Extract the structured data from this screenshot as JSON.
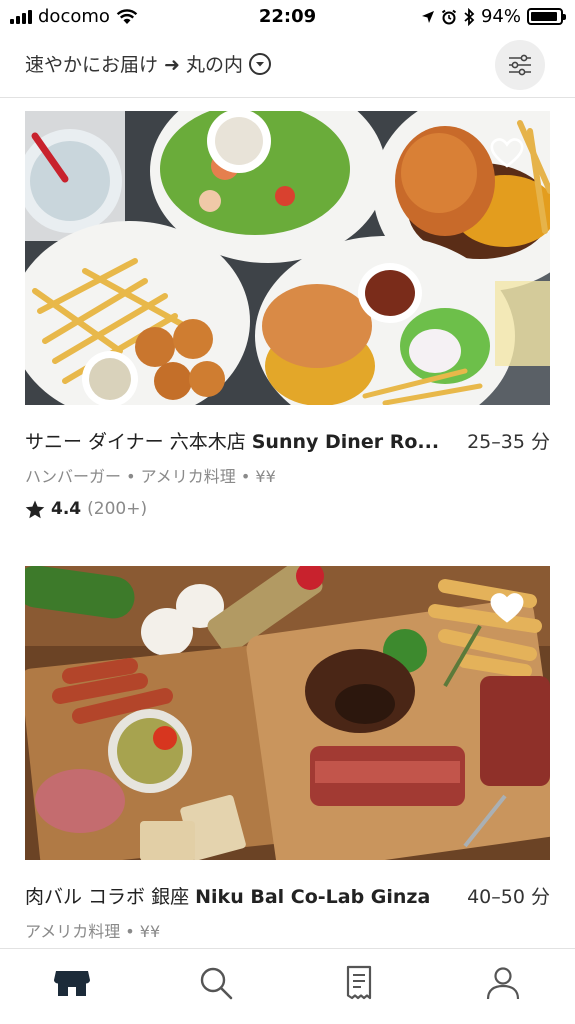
{
  "status_bar": {
    "carrier": "docomo",
    "time": "22:09",
    "battery_percent": "94%",
    "battery_level": 0.94
  },
  "header": {
    "location_text": "速やかにお届け ➜ 丸の内"
  },
  "restaurants": [
    {
      "name_ja": "サニー ダイナー 六本木店",
      "name_en": "Sunny Diner Ro...",
      "eta": "25–35 分",
      "meta": "ハンバーガー • アメリカ料理 • ¥¥",
      "rating": "4.4",
      "rating_count": "(200+)"
    },
    {
      "name_ja": "肉バル コラボ 銀座",
      "name_en": "Niku Bal Co-Lab Ginza",
      "eta": "40–50 分",
      "meta": "アメリカ料理 • ¥¥"
    }
  ],
  "colors": {
    "accent_dark": "#1c2b39",
    "muted_text": "#8a8a8a"
  },
  "icons": {
    "tab_home": "storefront-icon",
    "tab_search": "search-icon",
    "tab_orders": "receipt-icon",
    "tab_account": "person-icon"
  }
}
